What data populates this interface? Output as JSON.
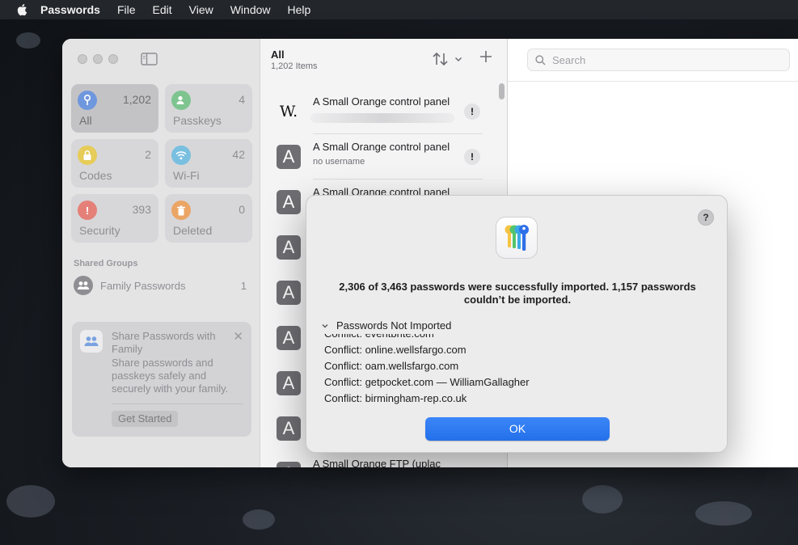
{
  "menubar": {
    "items": [
      "Passwords",
      "File",
      "Edit",
      "View",
      "Window",
      "Help"
    ]
  },
  "sidebar": {
    "tiles": [
      {
        "label": "All",
        "count": "1,202",
        "icon": "key-icon",
        "color": "#3478f6",
        "active": true
      },
      {
        "label": "Passkeys",
        "count": "4",
        "icon": "person-badge-icon",
        "color": "#34c759",
        "active": false
      },
      {
        "label": "Codes",
        "count": "2",
        "icon": "lock-clock-icon",
        "color": "#f2c500",
        "active": false
      },
      {
        "label": "Wi-Fi",
        "count": "42",
        "icon": "wifi-icon",
        "color": "#32ade6",
        "active": false
      },
      {
        "label": "Security",
        "count": "393",
        "icon": "exclamation-icon",
        "color": "#ff3b30",
        "active": false
      },
      {
        "label": "Deleted",
        "count": "0",
        "icon": "trash-icon",
        "color": "#ff9500",
        "active": false
      }
    ],
    "shared_groups_title": "Shared Groups",
    "group": {
      "name": "Family Passwords",
      "count": "1"
    },
    "share_card": {
      "title": "Share Passwords with Family",
      "description": "Share passwords and passkeys safely and securely with your family.",
      "button": "Get Started"
    }
  },
  "list": {
    "title": "All",
    "subtitle": "1,202 Items",
    "rows": [
      {
        "letter": "W.",
        "title": "A Small Orange control panel",
        "subtitle": "",
        "warning": "!"
      },
      {
        "letter": "A",
        "title": "A Small Orange control panel",
        "subtitle": "no username",
        "warning": "!"
      },
      {
        "letter": "A",
        "title": "A Small Orange control panel",
        "subtitle": "",
        "warning": ""
      },
      {
        "letter": "A",
        "title": "",
        "subtitle": "",
        "warning": ""
      },
      {
        "letter": "A",
        "title": "",
        "subtitle": "",
        "warning": ""
      },
      {
        "letter": "A",
        "title": "",
        "subtitle": "",
        "warning": ""
      },
      {
        "letter": "A",
        "title": "",
        "subtitle": "",
        "warning": ""
      },
      {
        "letter": "A",
        "title": "",
        "subtitle": "",
        "warning": ""
      },
      {
        "letter": "A",
        "title": "A Small Orange FTP (uplac",
        "subtitle": "",
        "warning": ""
      }
    ]
  },
  "detail": {
    "search_placeholder": "Search"
  },
  "dialog": {
    "help": "?",
    "message": "2,306 of 3,463 passwords were successfully imported. 1,157 passwords couldn’t be imported.",
    "disclosure_label": "Passwords Not Imported",
    "conflicts": [
      "Conflict: eventbrite.com",
      "Conflict: online.wellsfargo.com",
      "Conflict: oam.wellsfargo.com",
      "Conflict: getpocket.com — WilliamGallagher",
      "Conflict: birmingham-rep.co.uk"
    ],
    "ok_label": "OK",
    "accent": "#2f7cf6"
  }
}
